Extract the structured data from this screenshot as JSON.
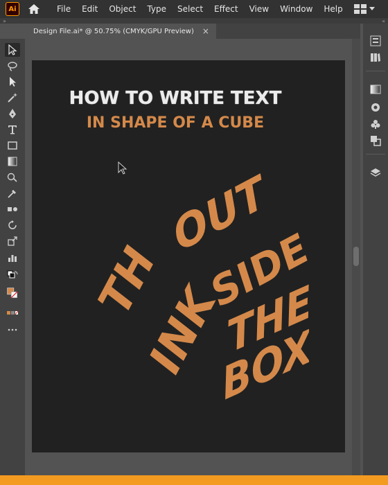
{
  "app": {
    "icon_label": "Ai"
  },
  "menu": {
    "items": [
      "File",
      "Edit",
      "Object",
      "Type",
      "Select",
      "Effect",
      "View",
      "Window",
      "Help"
    ]
  },
  "document_tab": {
    "title": "Design File.ai* @ 50.75% (CMYK/GPU Preview)",
    "close": "×"
  },
  "artwork": {
    "title_line_1": "HOW TO WRITE TEXT",
    "title_line_2": "IN SHAPE OF A CUBE",
    "cube_words": {
      "top": "OUT",
      "left_top": "TH",
      "left_bottom": "INK",
      "right_1": "SIDE",
      "right_2": "THE",
      "right_3": "BOX"
    }
  },
  "tools": [
    "selection-tool",
    "lasso-tool",
    "direct-selection-tool",
    "magic-wand-tool",
    "pen-tool",
    "type-tool",
    "rectangle-tool",
    "gradient-tool",
    "shape-builder-tool",
    "eyedropper-tool",
    "blend-tool",
    "rotate-tool",
    "scale-tool",
    "graph-tool"
  ],
  "right_panels": [
    "properties-panel",
    "libraries-panel",
    "gradient-panel",
    "appearance-panel",
    "symbols-panel",
    "pathfinder-panel",
    "layers-panel"
  ],
  "colors": {
    "accent_orange": "#d4894a",
    "artboard_bg": "#212121",
    "ui_dark": "#323232",
    "ui_mid": "#424242",
    "canvas_gray": "#535353",
    "bottom_strip": "#f39a21"
  }
}
